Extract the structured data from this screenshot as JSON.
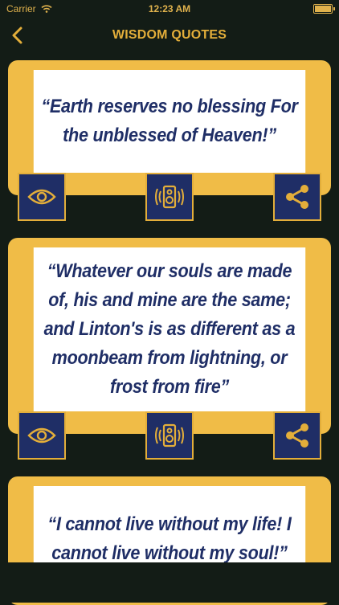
{
  "status": {
    "carrier": "Carrier",
    "time": "12:23 AM"
  },
  "nav": {
    "title": "WISDOM QUOTES"
  },
  "quotes": [
    {
      "text": "“Earth reserves no blessing For the unblessed of Heaven!”"
    },
    {
      "text": "“Whatever our souls are made of, his and mine are the same; and Linton's is as different as a moonbeam from lightning, or frost from fire”"
    },
    {
      "text": "“I cannot live without my life! I cannot live without my soul!”"
    }
  ],
  "icons": {
    "view": "eye-icon",
    "speak": "speaker-icon",
    "share": "share-icon",
    "back": "chevron-left-icon"
  },
  "colors": {
    "background": "#131c16",
    "card": "#f0bc47",
    "accent": "#e3ae3a",
    "button": "#1f2e66",
    "text": "#1f2e66"
  }
}
